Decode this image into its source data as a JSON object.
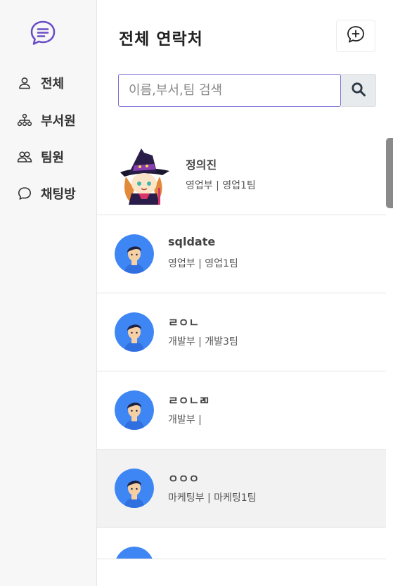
{
  "sidebar": {
    "logo_icon": "chat-bubble-icon",
    "items": [
      {
        "label": "전체",
        "icon": "person-icon"
      },
      {
        "label": "부서원",
        "icon": "org-chart-icon"
      },
      {
        "label": "팀원",
        "icon": "people-icon"
      },
      {
        "label": "채팅방",
        "icon": "chat-icon"
      }
    ]
  },
  "header": {
    "title": "전체 연락처",
    "add_chat_icon": "plus-bubble-icon"
  },
  "search": {
    "placeholder": "이름,부서,팀 검색",
    "value": "",
    "button_icon": "search-icon"
  },
  "contacts": [
    {
      "name": "정의진",
      "dept": "영업부 | 영업1팀",
      "avatar": "custom-character-avatar"
    },
    {
      "name": "sqldate",
      "dept": "영업부 | 영업1팀",
      "avatar": "default-user-avatar"
    },
    {
      "name": "ㄹㅇㄴ",
      "dept": "개발부 | 개발3팀",
      "avatar": "default-user-avatar"
    },
    {
      "name": "ㄹㅇㄴㄻ",
      "dept": "개발부 |",
      "avatar": "default-user-avatar"
    },
    {
      "name": "ㅇㅇㅇ",
      "dept": "마케팅부 | 마케팅1팀",
      "avatar": "default-user-avatar",
      "selected": true
    }
  ],
  "colors": {
    "accent": "#6a4fc6",
    "sidebar_bg": "#f7f7f7",
    "avatar_bg": "#3f86f5",
    "selected_row": "#f2f2f2"
  }
}
